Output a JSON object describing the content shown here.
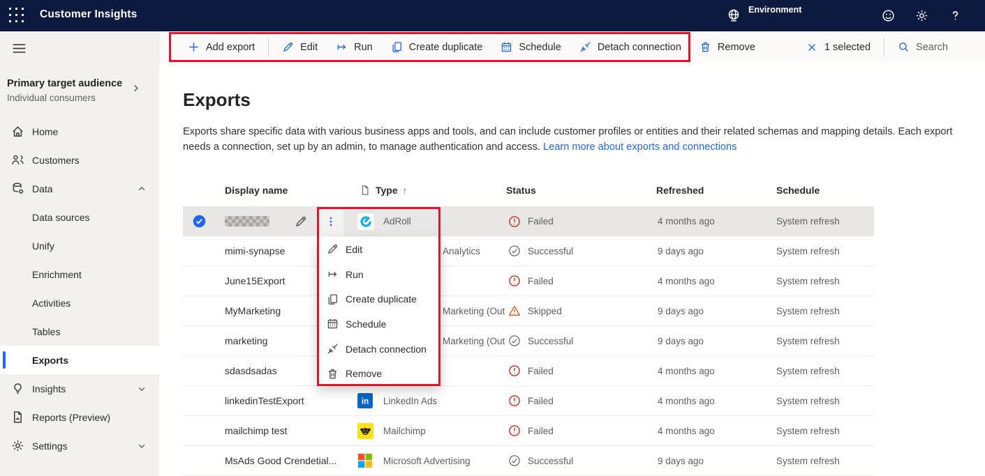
{
  "app": {
    "title": "Customer Insights"
  },
  "topbar": {
    "environment_label": "Environment",
    "icons": [
      "app-launcher",
      "environment-globe",
      "feedback-smiley",
      "settings-gear",
      "help-question"
    ]
  },
  "toolbar": {
    "buttons": [
      {
        "label": "Add export",
        "icon": "plus"
      },
      {
        "label": "Edit",
        "icon": "pencil"
      },
      {
        "label": "Run",
        "icon": "run"
      },
      {
        "label": "Create duplicate",
        "icon": "copy"
      },
      {
        "label": "Schedule",
        "icon": "calendar"
      },
      {
        "label": "Detach connection",
        "icon": "detach"
      },
      {
        "label": "Remove",
        "icon": "trash"
      }
    ],
    "selection_label": "1 selected",
    "selection_icon": "dismiss-x",
    "search_label": "Search",
    "search_icon": "search"
  },
  "sidebar": {
    "audience": {
      "title": "Primary target audience",
      "subtitle": "Individual consumers"
    },
    "items": [
      {
        "label": "Home",
        "icon": "home"
      },
      {
        "label": "Customers",
        "icon": "people"
      },
      {
        "label": "Data",
        "icon": "database",
        "chevron": "up"
      },
      {
        "label": "Data sources",
        "indent": true
      },
      {
        "label": "Unify",
        "indent": true
      },
      {
        "label": "Enrichment",
        "indent": true
      },
      {
        "label": "Activities",
        "indent": true
      },
      {
        "label": "Tables",
        "indent": true
      },
      {
        "label": "Exports",
        "indent": true,
        "selected": true
      },
      {
        "label": "Insights",
        "icon": "lightbulb",
        "chevron": "down"
      },
      {
        "label": "Reports (Preview)",
        "icon": "report"
      },
      {
        "label": "Settings",
        "icon": "gear",
        "chevron": "down"
      }
    ]
  },
  "page": {
    "title": "Exports",
    "description": "Exports share specific data with various business apps and tools, and can include customer profiles or entities and their related schemas and mapping details. Each export needs a connection, set up by an admin, to manage authentication and access. ",
    "link_text": "Learn more about exports and connections"
  },
  "table": {
    "columns": [
      "Display name",
      "Type",
      "Status",
      "Refreshed",
      "Schedule"
    ],
    "sort": {
      "column": "Type",
      "direction": "ascending",
      "arrow": "↑"
    },
    "rows": [
      {
        "selected": true,
        "name": "",
        "name_redacted": true,
        "type": "AdRoll",
        "type_icon": "adroll",
        "status": "Failed",
        "status_kind": "failed",
        "refreshed": "4 months ago",
        "schedule": "System refresh"
      },
      {
        "name": "mimi-synapse",
        "type_visible_partial": "Analytics",
        "status": "Successful",
        "status_kind": "success",
        "refreshed": "9 days ago",
        "schedule": "System refresh"
      },
      {
        "name": "June15Export",
        "status": "Failed",
        "status_kind": "failed",
        "refreshed": "4 months ago",
        "schedule": "System refresh"
      },
      {
        "name": "MyMarketing",
        "type_visible_partial": "Marketing (Out",
        "status": "Skipped",
        "status_kind": "skipped",
        "refreshed": "9 days ago",
        "schedule": "System refresh"
      },
      {
        "name": "marketing",
        "type_visible_partial": "Marketing (Out",
        "status": "Successful",
        "status_kind": "success",
        "refreshed": "9 days ago",
        "schedule": "System refresh"
      },
      {
        "name": "sdasdsadas",
        "status": "Failed",
        "status_kind": "failed",
        "refreshed": "4 months ago",
        "schedule": "System refresh"
      },
      {
        "name": "linkedinTestExport",
        "type": "LinkedIn Ads",
        "type_icon": "linkedin",
        "status": "Failed",
        "status_kind": "failed",
        "refreshed": "4 months ago",
        "schedule": "System refresh"
      },
      {
        "name": "mailchimp test",
        "type": "Mailchimp",
        "type_icon": "mailchimp",
        "status": "Failed",
        "status_kind": "failed",
        "refreshed": "4 months ago",
        "schedule": "System refresh"
      },
      {
        "name": "MsAds Good Crendetial...",
        "type": "Microsoft Advertising",
        "type_icon": "microsoft",
        "status": "Successful",
        "status_kind": "success",
        "refreshed": "9 days ago",
        "schedule": "System refresh"
      }
    ]
  },
  "context_menu": {
    "items": [
      {
        "label": "Edit",
        "icon": "pencil"
      },
      {
        "label": "Run",
        "icon": "run"
      },
      {
        "label": "Create duplicate",
        "icon": "copy"
      },
      {
        "label": "Schedule",
        "icon": "calendar"
      },
      {
        "label": "Detach connection",
        "icon": "detach"
      },
      {
        "label": "Remove",
        "icon": "trash"
      }
    ]
  },
  "colors": {
    "topbar": "#0b1a3e",
    "accent_blue": "#2266e3",
    "annotation_red": "#e8112d",
    "status_failed": "#c42d24",
    "status_skipped": "#d8531b",
    "status_success": "#6f6d6b"
  }
}
